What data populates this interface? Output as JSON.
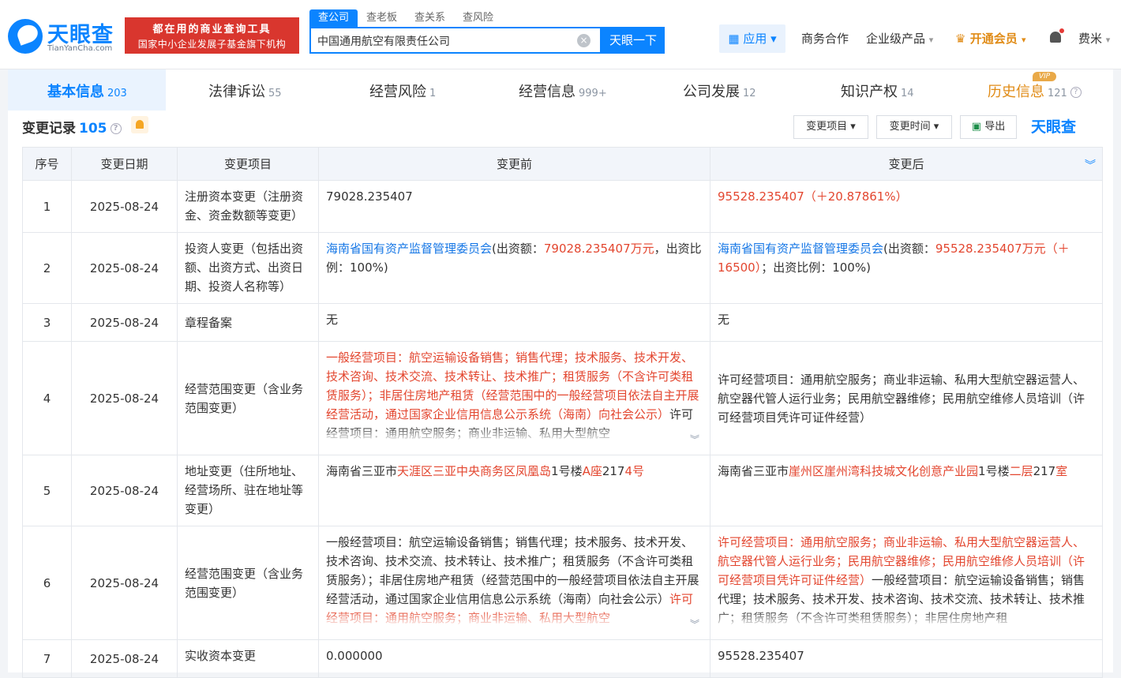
{
  "header": {
    "logo_text": "天眼查",
    "logo_sub": "TianYanCha.com",
    "slogan_line1": "都在用的商业查询工具",
    "slogan_line2": "国家中小企业发展子基金旗下机构",
    "search_tabs": [
      "查公司",
      "查老板",
      "查关系",
      "查风险"
    ],
    "search_value": "中国通用航空有限责任公司",
    "search_button": "天眼一下",
    "app_button": "应用",
    "nav": [
      "商务合作",
      "企业级产品",
      "开通会员",
      "费米"
    ]
  },
  "tabs": [
    {
      "label": "基本信息",
      "count": "203"
    },
    {
      "label": "法律诉讼",
      "count": "55"
    },
    {
      "label": "经营风险",
      "count": "1"
    },
    {
      "label": "经营信息",
      "count": "999+"
    },
    {
      "label": "公司发展",
      "count": "12"
    },
    {
      "label": "知识产权",
      "count": "14"
    },
    {
      "label": "历史信息",
      "count": "121"
    }
  ],
  "vip_badge": "VIP",
  "section": {
    "title": "变更记录",
    "count": "105",
    "filter_item": "变更项目",
    "filter_time": "变更时间",
    "export": "导出",
    "brand": "天眼查"
  },
  "table": {
    "headers": [
      "序号",
      "变更日期",
      "变更项目",
      "变更前",
      "变更后"
    ],
    "rows": [
      {
        "no": "1",
        "date": "2025-08-24",
        "item": "注册资本变更（注册资金、资金数额等变更）",
        "before": "79028.235407",
        "after": "95528.235407（＋20.87861%）"
      },
      {
        "no": "2",
        "date": "2025-08-24",
        "item": "投资人变更（包括出资额、出资方式、出资日期、投资人名称等）",
        "before_name": "海南省国有资产监督管理委员会",
        "before_a": "(出资额：",
        "before_amt": "79028.235407万元",
        "before_b": "，出资比例：100%)",
        "after_name": "海南省国有资产监督管理委员会",
        "after_a": "(出资额：",
        "after_amt": "95528.235407万元（＋16500）",
        "after_b": "；出资比例：100%)"
      },
      {
        "no": "3",
        "date": "2025-08-24",
        "item": "章程备案",
        "before": "无",
        "after": "无"
      },
      {
        "no": "4",
        "date": "2025-08-24",
        "item": "经营范围变更（含业务范围变更）",
        "before_red": "一般经营项目：航空运输设备销售；销售代理；技术服务、技术开发、技术咨询、技术交流、技术转让、技术推广；租赁服务（不含许可类租赁服务）；非居住房地产租赁（经营范围中的一般经营项目依法自主开展经营活动，通过国家企业信用信息公示系统（海南）向社会公示）",
        "before_rest": "许可经营项目：通用航空服务；商业非运输、私用大型航空",
        "after": "许可经营项目：通用航空服务；商业非运输、私用大型航空器运营人、航空器代管人运行业务；民用航空器维修；民用航空维修人员培训（许可经营项目凭许可证件经营）"
      },
      {
        "no": "5",
        "date": "2025-08-24",
        "item": "地址变更（住所地址、经营场所、驻在地址等变更）",
        "before_a": "海南省三亚市",
        "before_b": "天涯区三亚中央商务区凤凰岛",
        "before_c": "1号楼",
        "before_d": "A座",
        "before_e": "217",
        "before_f": "4号",
        "after_a": "海南省三亚市",
        "after_b": "崖州区崖州湾科技城文化创意产业园",
        "after_c": "1号楼",
        "after_d": "二层",
        "after_e": "217",
        "after_f": "室"
      },
      {
        "no": "6",
        "date": "2025-08-24",
        "item": "经营范围变更（含业务范围变更）",
        "before": "一般经营项目：航空运输设备销售；销售代理；技术服务、技术开发、技术咨询、技术交流、技术转让、技术推广；租赁服务（不含许可类租赁服务）；非居住房地产租赁（经营范围中的一般经营项目依法自主开展经营活动，通过国家企业信用信息公示系统（海南）向社会公示）",
        "before_red": "许可经营项目：通用航空服务；商业非运输、私用大型航空",
        "after_red": "许可经营项目：通用航空服务；商业非运输、私用大型航空器运营人、航空器代管人运行业务；民用航空器维修；民用航空维修人员培训（许可经营项目凭许可证件经营）",
        "after_rest": "一般经营项目：航空运输设备销售；销售代理；技术服务、技术开发、技术咨询、技术交流、技术转让、技术推广；租赁服务（不含许可类租赁服务）；非居住房地产租"
      },
      {
        "no": "7",
        "date": "2025-08-24",
        "item": "实收资本变更",
        "before": "0.000000",
        "after": "95528.235407"
      }
    ]
  },
  "colors": {
    "accent": "#0b84ff",
    "change_red": "#e3462f",
    "vip": "#e08b16"
  }
}
